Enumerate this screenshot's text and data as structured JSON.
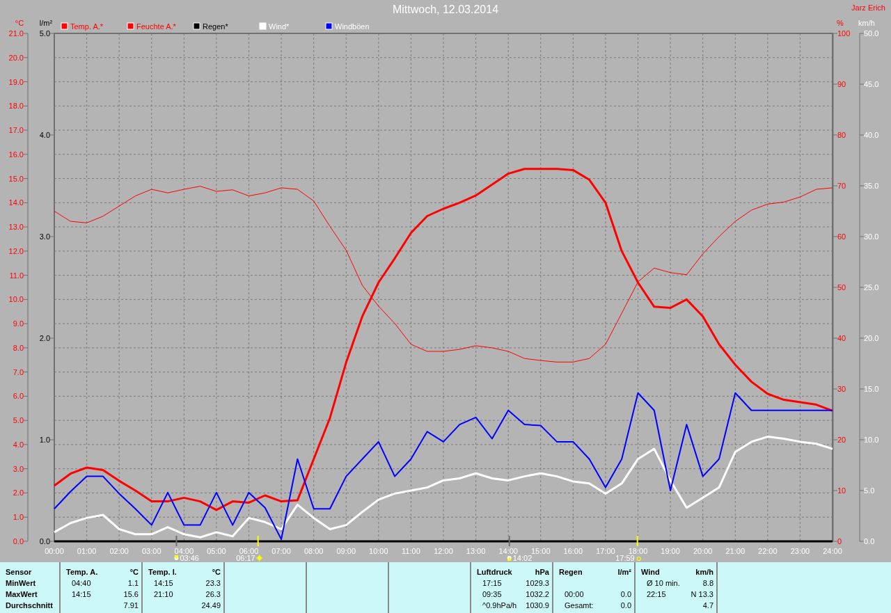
{
  "header": {
    "title": "Mittwoch, 12.03.2014",
    "author": "Jarz Erich"
  },
  "chart": {
    "rain_axis": {
      "unit": "l/m²",
      "labels": [
        "5.0",
        "4.0",
        "3.0",
        "2.0",
        "1.0",
        "0.0"
      ]
    },
    "chart_data": {
      "type": "line",
      "grid": true,
      "legend": "top",
      "x": [
        0,
        0.5,
        1,
        1.5,
        2,
        2.5,
        3,
        3.5,
        4,
        4.5,
        5,
        5.5,
        6,
        6.5,
        7,
        7.5,
        8,
        8.5,
        9,
        9.5,
        10,
        10.5,
        11,
        11.5,
        12,
        12.5,
        13,
        13.5,
        14,
        14.5,
        15,
        15.5,
        16,
        16.5,
        17,
        17.5,
        18,
        18.5,
        19,
        19.5,
        20,
        20.5,
        21,
        21.5,
        22,
        22.5,
        23,
        23.5,
        24
      ],
      "xlim": [
        0,
        24
      ],
      "xticks": [
        {
          "value": 0,
          "label": "00:00"
        },
        {
          "value": 1,
          "label": "01:00"
        },
        {
          "value": 2,
          "label": "02:00"
        },
        {
          "value": 3,
          "label": "03:00"
        },
        {
          "value": 4,
          "label": "04:00"
        },
        {
          "value": 5,
          "label": "05:00"
        },
        {
          "value": 6,
          "label": "06:00"
        },
        {
          "value": 7,
          "label": "07:00"
        },
        {
          "value": 8,
          "label": "08:00"
        },
        {
          "value": 9,
          "label": "09:00"
        },
        {
          "value": 10,
          "label": "10:00"
        },
        {
          "value": 11,
          "label": "11:00"
        },
        {
          "value": 12,
          "label": "12:00"
        },
        {
          "value": 13,
          "label": "13:00"
        },
        {
          "value": 14,
          "label": "14:00"
        },
        {
          "value": 15,
          "label": "15:00"
        },
        {
          "value": 16,
          "label": "16:00"
        },
        {
          "value": 17,
          "label": "17:00"
        },
        {
          "value": 18,
          "label": "18:00"
        },
        {
          "value": 19,
          "label": "19:00"
        },
        {
          "value": 20,
          "label": "20:00"
        },
        {
          "value": 21,
          "label": "21:00"
        },
        {
          "value": 22,
          "label": "22:00"
        },
        {
          "value": 23,
          "label": "23:00"
        },
        {
          "value": 24,
          "label": "24:00"
        }
      ],
      "ylabel": "°C",
      "ylim": [
        0,
        21
      ],
      "yticks": [
        {
          "value": 0,
          "label": "0.0"
        },
        {
          "value": 1,
          "label": "1.0"
        },
        {
          "value": 2,
          "label": "2.0"
        },
        {
          "value": 3,
          "label": "3.0"
        },
        {
          "value": 4,
          "label": "4.0"
        },
        {
          "value": 5,
          "label": "5.0"
        },
        {
          "value": 6,
          "label": "6.0"
        },
        {
          "value": 7,
          "label": "7.0"
        },
        {
          "value": 8,
          "label": "8.0"
        },
        {
          "value": 9,
          "label": "9.0"
        },
        {
          "value": 10,
          "label": "10.0"
        },
        {
          "value": 11,
          "label": "11.0"
        },
        {
          "value": 12,
          "label": "12.0"
        },
        {
          "value": 13,
          "label": "13.0"
        },
        {
          "value": 14,
          "label": "14.0"
        },
        {
          "value": 15,
          "label": "15.0"
        },
        {
          "value": 16,
          "label": "16.0"
        },
        {
          "value": 17,
          "label": "17.0"
        },
        {
          "value": 18,
          "label": "18.0"
        },
        {
          "value": 19,
          "label": "19.0"
        },
        {
          "value": 20,
          "label": "20.0"
        },
        {
          "value": 21,
          "label": "21.0"
        }
      ],
      "y2label": "%",
      "y2lim": [
        0,
        100
      ],
      "y2ticks": [
        {
          "value": 0,
          "label": "0"
        },
        {
          "value": 10,
          "label": "10"
        },
        {
          "value": 20,
          "label": "20"
        },
        {
          "value": 30,
          "label": "30"
        },
        {
          "value": 40,
          "label": "40"
        },
        {
          "value": 50,
          "label": "50"
        },
        {
          "value": 60,
          "label": "60"
        },
        {
          "value": 70,
          "label": "70"
        },
        {
          "value": 80,
          "label": "80"
        },
        {
          "value": 90,
          "label": "90"
        },
        {
          "value": 100,
          "label": "100"
        }
      ],
      "y3label": "km/h",
      "y3lim": [
        0,
        50
      ],
      "y3ticks": [
        {
          "value": 0,
          "label": "0.0"
        },
        {
          "value": 5,
          "label": "5.0"
        },
        {
          "value": 10,
          "label": "10.0"
        },
        {
          "value": 15,
          "label": "15.0"
        },
        {
          "value": 20,
          "label": "20.0"
        },
        {
          "value": 25,
          "label": "25.0"
        },
        {
          "value": 30,
          "label": "30.0"
        },
        {
          "value": 35,
          "label": "35.0"
        },
        {
          "value": 40,
          "label": "40.0"
        },
        {
          "value": 45,
          "label": "45.0"
        },
        {
          "value": 50,
          "label": "50.0"
        }
      ],
      "series": [
        {
          "name": "Temp. A.*",
          "color": "#ff0000",
          "values": [
            2.3,
            2.8,
            3.05,
            2.95,
            2.5,
            2.1,
            1.65,
            1.65,
            1.8,
            1.65,
            1.3,
            1.65,
            1.6,
            1.9,
            1.65,
            1.7,
            3.4,
            5.1,
            7.4,
            9.3,
            10.7,
            11.7,
            12.75,
            13.45,
            13.75,
            14.0,
            14.3,
            14.75,
            15.2,
            15.4,
            15.4,
            15.4,
            15.35,
            14.95,
            14.0,
            12.0,
            10.7,
            9.7,
            9.65,
            10.0,
            9.3,
            8.15,
            7.3,
            6.6,
            6.1,
            5.85,
            5.75,
            5.65,
            5.4
          ]
        },
        {
          "name": "Feuchte A.*",
          "color": "#ff0000",
          "axis": "y2",
          "values": [
            65,
            63,
            62.7,
            64,
            66,
            68,
            69.3,
            68.6,
            69.3,
            69.9,
            68.9,
            69.2,
            68,
            68.6,
            69.6,
            69.3,
            67,
            62,
            57.3,
            50.4,
            46.3,
            42.9,
            38.8,
            37.4,
            37.4,
            37.8,
            38.5,
            38.1,
            37.4,
            36,
            35.6,
            35.3,
            35.3,
            36,
            38.8,
            44.9,
            51.1,
            53.8,
            52.9,
            52.5,
            56.6,
            60,
            63,
            65.2,
            66.4,
            66.8,
            67.8,
            69.3,
            69.6
          ]
        },
        {
          "name": "Regen*",
          "color": "#000000",
          "values": [
            0,
            0,
            0,
            0,
            0,
            0,
            0,
            0,
            0,
            0,
            0,
            0,
            0,
            0,
            0,
            0,
            0,
            0,
            0,
            0,
            0,
            0,
            0,
            0,
            0,
            0,
            0,
            0,
            0,
            0,
            0,
            0,
            0,
            0,
            0,
            0,
            0,
            0,
            0,
            0,
            0,
            0,
            0,
            0,
            0,
            0,
            0,
            0,
            0
          ]
        },
        {
          "name": "Wind*",
          "color": "#ffffff",
          "axis": "y3",
          "values": [
            0.9,
            1.8,
            2.3,
            2.6,
            1.2,
            0.7,
            0.7,
            1.4,
            0.7,
            0.4,
            0.9,
            0.5,
            2.3,
            1.9,
            1.2,
            3.6,
            2.3,
            1.2,
            1.6,
            2.9,
            4.1,
            4.7,
            5.0,
            5.3,
            6.0,
            6.2,
            6.7,
            6.2,
            6.0,
            6.4,
            6.7,
            6.4,
            5.9,
            5.7,
            4.7,
            5.7,
            8.1,
            9.1,
            6.0,
            3.3,
            4.3,
            5.3,
            8.8,
            9.8,
            10.3,
            10.1,
            9.8,
            9.6,
            9.1
          ]
        },
        {
          "name": "Windböen",
          "color": "#0000ff",
          "axis": "y3",
          "values": [
            3.2,
            4.9,
            6.4,
            6.4,
            4.7,
            3.2,
            1.6,
            4.8,
            1.6,
            1.6,
            4.8,
            1.6,
            4.8,
            3.3,
            0.2,
            8.1,
            3.2,
            3.2,
            6.4,
            8.1,
            9.8,
            6.4,
            8.1,
            10.8,
            9.8,
            11.5,
            12.2,
            10.1,
            12.9,
            11.5,
            11.4,
            9.8,
            9.8,
            8.1,
            5.3,
            8.1,
            14.6,
            12.9,
            5.0,
            11.5,
            6.4,
            8.1,
            14.6,
            12.9,
            12.9,
            12.9,
            12.9,
            12.9,
            12.9
          ]
        }
      ],
      "annotations": [
        "03:46",
        "06:17",
        "14:02",
        "17:59"
      ]
    }
  },
  "summary": {
    "row_labels": [
      "Sensor",
      "MinWert",
      "MaxWert",
      "Durchschnitt"
    ],
    "blocks": [
      {
        "kind": "sensor",
        "title": "Temp. A.",
        "unit": "°C",
        "rows": [
          {
            "time": "04:40",
            "value": "1.1"
          },
          {
            "time": "14:15",
            "value": "15.6"
          },
          {
            "value": "7.91"
          }
        ]
      },
      {
        "kind": "sensor",
        "title": "Temp. I.",
        "unit": "°C",
        "rows": [
          {
            "time": "14:15",
            "value": "23.3"
          },
          {
            "time": "21:10",
            "value": "26.3"
          },
          {
            "value": "24.49"
          }
        ]
      },
      {
        "kind": "blank"
      },
      {
        "kind": "blank"
      },
      {
        "kind": "blank"
      },
      {
        "kind": "sensor",
        "title": "Luftdruck",
        "unit": "hPa",
        "rows": [
          {
            "time": "17:15",
            "value": "1029.3"
          },
          {
            "time": "09:35",
            "value": "1032.2"
          },
          {
            "time": "^0.9hPa/h",
            "value": "1030.9"
          }
        ]
      },
      {
        "kind": "sensor",
        "title": "Regen",
        "unit": "l/m²",
        "rows": [
          {},
          {
            "time": "00:00",
            "value": "0.0"
          },
          {
            "time": "Gesamt:",
            "value": "0.0"
          }
        ]
      },
      {
        "kind": "sensor",
        "title": "Wind",
        "unit": "km/h",
        "rows": [
          {
            "time": "Ø 10 min.",
            "value": "8.8"
          },
          {
            "time": "22:15",
            "value": "N 13.3"
          },
          {
            "value": "4.7"
          }
        ]
      }
    ]
  }
}
